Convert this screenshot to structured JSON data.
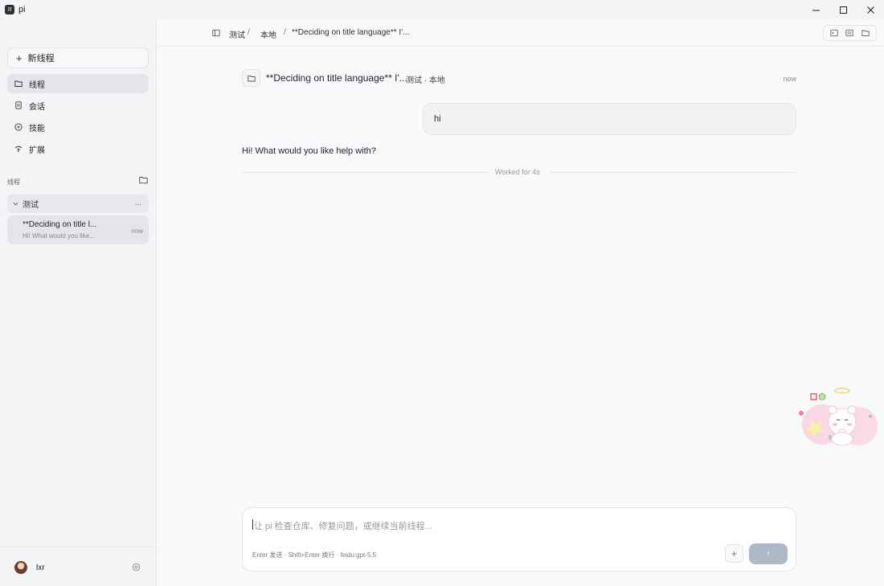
{
  "app": {
    "title": "pi",
    "logo_glyph": "π"
  },
  "window_controls": {
    "minimize": "minimize-icon",
    "maximize": "maximize-icon",
    "close": "close-icon"
  },
  "sidebar": {
    "new_thread_label": "新线程",
    "nav": [
      {
        "label": "线程",
        "icon": "folder-icon",
        "active": true
      },
      {
        "label": "会话",
        "icon": "document-icon",
        "active": false
      },
      {
        "label": "技能",
        "icon": "skill-icon",
        "active": false
      },
      {
        "label": "扩展",
        "icon": "extension-icon",
        "active": false
      }
    ],
    "section_label": "线程",
    "group": {
      "name": "测试",
      "more": "..."
    },
    "thread": {
      "title": "**Deciding on title l...",
      "preview": "Hi! What would you like...",
      "time": "now"
    },
    "user": {
      "name": "lxr"
    }
  },
  "topbar": {
    "breadcrumbs": [
      "测试",
      "本地",
      "**Deciding on title language** I'..."
    ],
    "separator": "/"
  },
  "conversation": {
    "title": "**Deciding on title language** I'...",
    "meta": "测试 · 本地",
    "time": "now",
    "messages": [
      {
        "role": "user",
        "text": "hi"
      },
      {
        "role": "assistant",
        "text": "Hi! What would you like help with?"
      }
    ],
    "worked": "Worked for 4s"
  },
  "composer": {
    "placeholder": "让 pi 检查仓库、修复问题，或继续当前线程...",
    "hint": "Enter 发送 · Shift+Enter 换行 ·  feidu:gpt-5.5",
    "add_label": "+",
    "send_label": "↑"
  }
}
